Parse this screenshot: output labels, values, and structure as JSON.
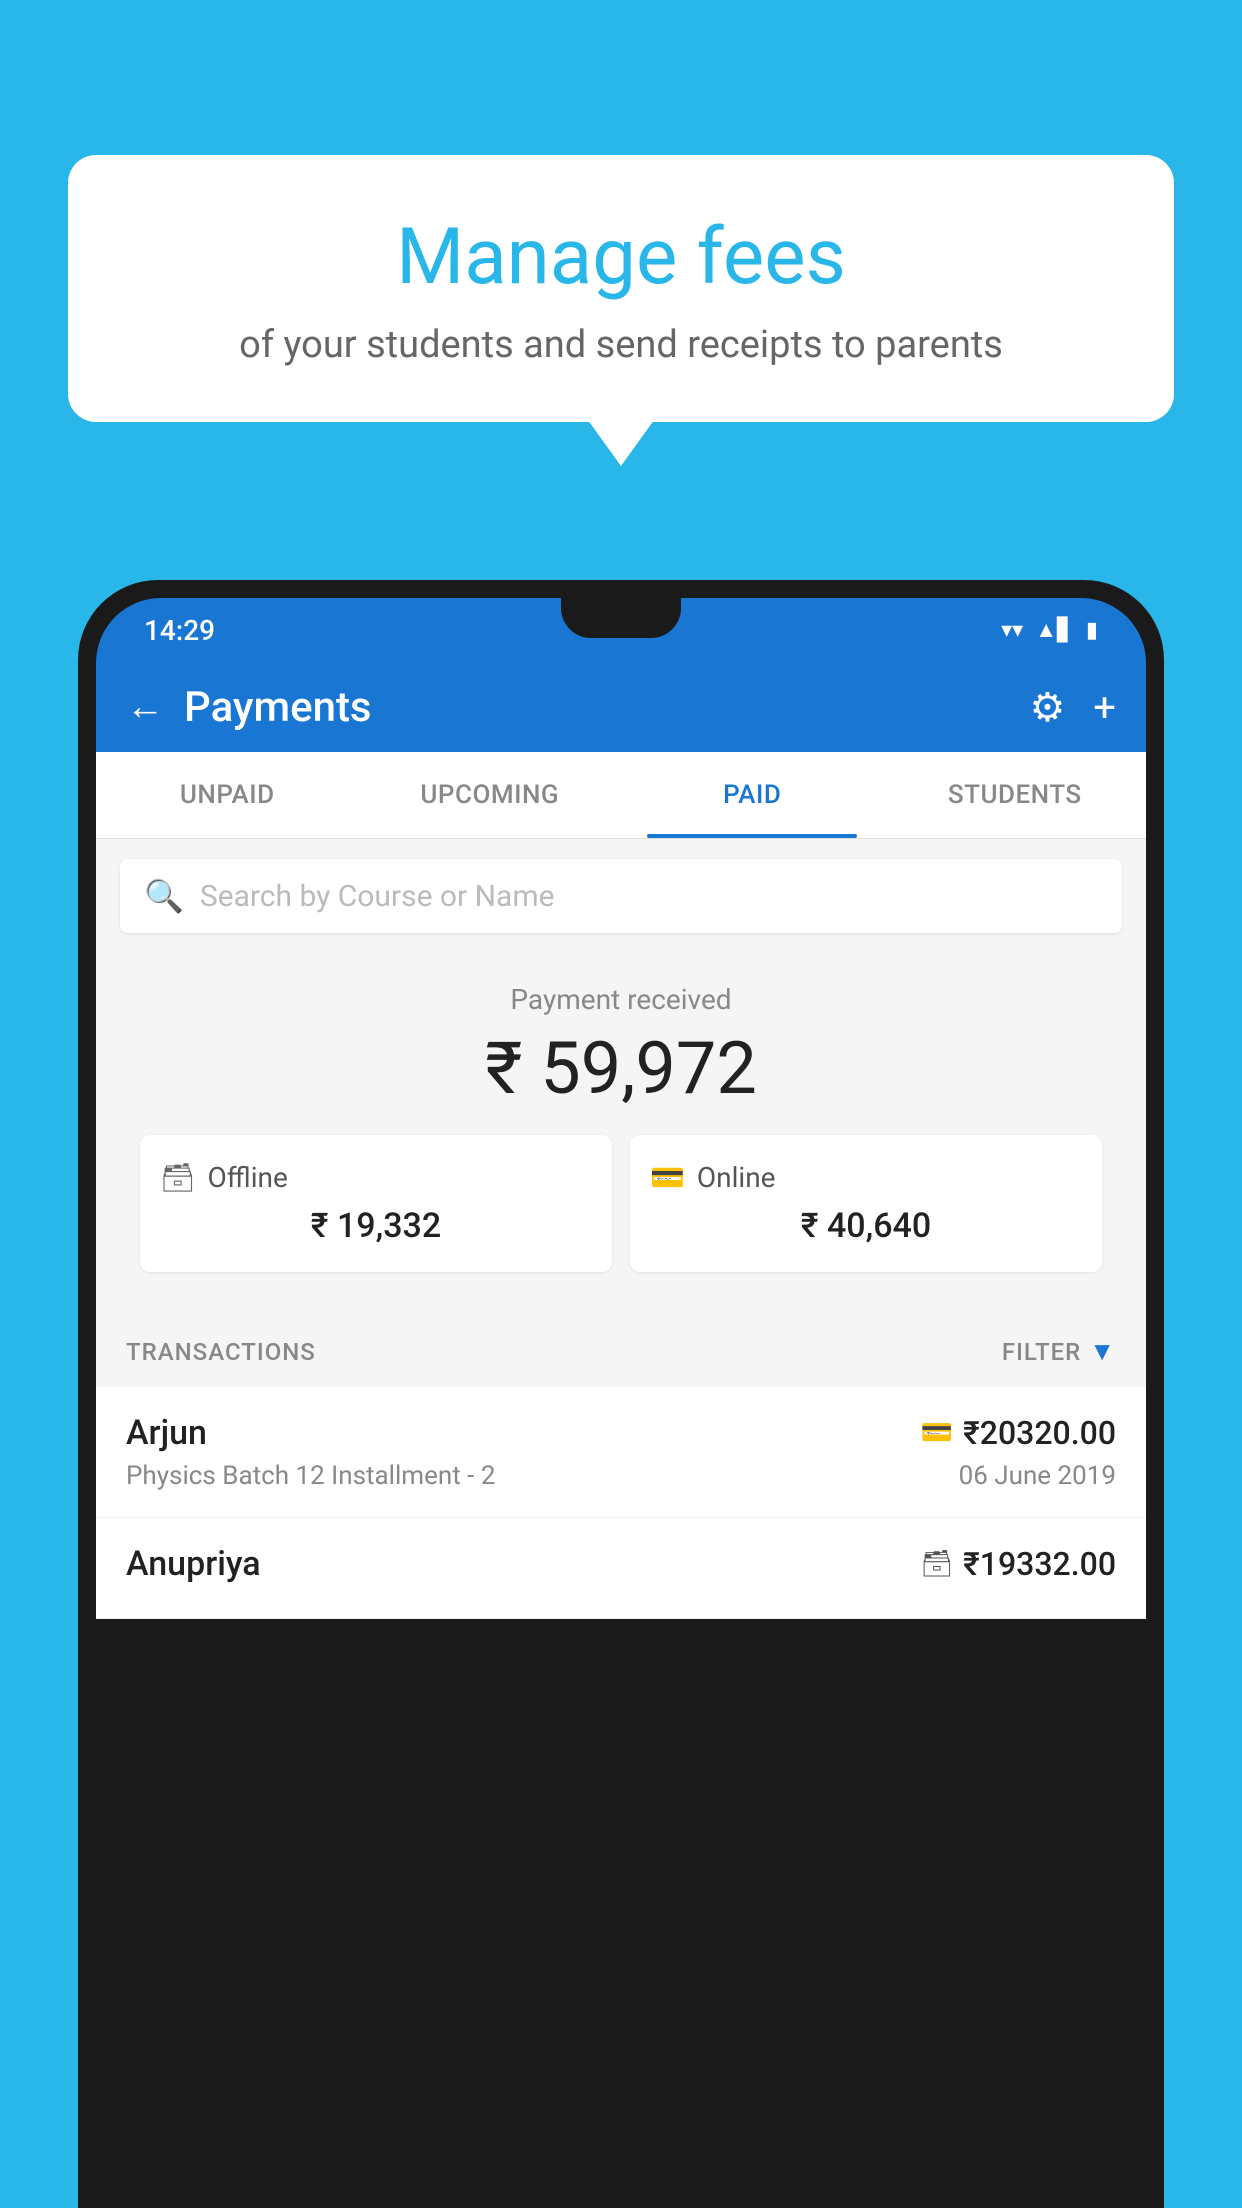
{
  "background_color": "#29b6e8",
  "bubble": {
    "title": "Manage fees",
    "subtitle": "of your students and send receipts to parents"
  },
  "status_bar": {
    "time": "14:29",
    "wifi": "▼",
    "signal": "▲",
    "battery": "▮"
  },
  "header": {
    "title": "Payments",
    "back_label": "←",
    "gear_label": "⚙",
    "plus_label": "+"
  },
  "tabs": [
    {
      "id": "unpaid",
      "label": "UNPAID",
      "active": false
    },
    {
      "id": "upcoming",
      "label": "UPCOMING",
      "active": false
    },
    {
      "id": "paid",
      "label": "PAID",
      "active": true
    },
    {
      "id": "students",
      "label": "STUDENTS",
      "active": false
    }
  ],
  "search": {
    "placeholder": "Search by Course or Name"
  },
  "payment_received": {
    "label": "Payment received",
    "amount": "₹ 59,972"
  },
  "cards": [
    {
      "type": "Offline",
      "amount": "₹ 19,332",
      "icon": "💳"
    },
    {
      "type": "Online",
      "amount": "₹ 40,640",
      "icon": "💳"
    }
  ],
  "transactions_label": "TRANSACTIONS",
  "filter_label": "FILTER",
  "transactions": [
    {
      "name": "Arjun",
      "course": "Physics Batch 12 Installment - 2",
      "amount": "₹20320.00",
      "date": "06 June 2019",
      "payment_type": "online"
    },
    {
      "name": "Anupriya",
      "course": "",
      "amount": "₹19332.00",
      "date": "",
      "payment_type": "offline"
    }
  ]
}
